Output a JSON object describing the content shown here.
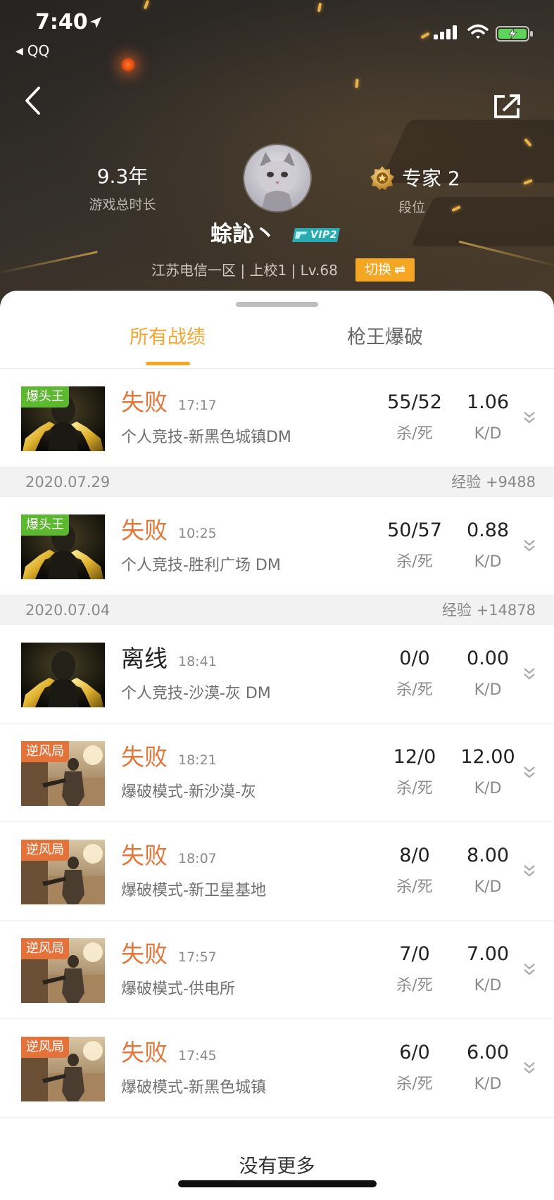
{
  "status_bar": {
    "time": "7:40",
    "back_app_label": "QQ"
  },
  "header": {
    "play_time_value": "9.3年",
    "play_time_label": "游戏总时长",
    "rank_value": "专家 2",
    "rank_label": "段位",
    "player_name": "蜍訫丶",
    "vip_badge": "VIP2",
    "server_info": "江苏电信一区 | 上校1 | Lv.68",
    "switch_label": "切换"
  },
  "tabs": [
    {
      "label": "所有战绩",
      "active": true
    },
    {
      "label": "枪王爆破",
      "active": false
    }
  ],
  "groups": [
    {
      "records": [
        {
          "thumb": "golden-pistols-image",
          "badge": "爆头王",
          "badge_color": "#5cb82e",
          "result": "失败",
          "result_color": "#e5773a",
          "time": "17:17",
          "mode": "个人竞技-新黑色城镇DM",
          "kills_deaths": "55/52",
          "kills_deaths_label": "杀/死",
          "kd": "1.06",
          "kd_label": "K/D"
        }
      ]
    },
    {
      "date": "2020.07.29",
      "exp": "经验 +9488",
      "records": [
        {
          "thumb": "golden-pistols-image",
          "badge": "爆头王",
          "badge_color": "#5cb82e",
          "result": "失败",
          "result_color": "#e5773a",
          "time": "10:25",
          "mode": "个人竞技-胜利广场 DM",
          "kills_deaths": "50/57",
          "kills_deaths_label": "杀/死",
          "kd": "0.88",
          "kd_label": "K/D"
        }
      ]
    },
    {
      "date": "2020.07.04",
      "exp": "经验 +14878",
      "records": [
        {
          "thumb": "golden-pistols-image",
          "result": "离线",
          "result_color": "#222222",
          "time": "18:41",
          "mode": "个人竞技-沙漠-灰 DM",
          "kills_deaths": "0/0",
          "kills_deaths_label": "杀/死",
          "kd": "0.00",
          "kd_label": "K/D"
        },
        {
          "thumb": "desert-soldier-image",
          "badge": "逆风局",
          "badge_color": "#e3733a",
          "result": "失败",
          "result_color": "#e5773a",
          "time": "18:21",
          "mode": "爆破模式-新沙漠-灰",
          "kills_deaths": "12/0",
          "kills_deaths_label": "杀/死",
          "kd": "12.00",
          "kd_label": "K/D"
        },
        {
          "thumb": "desert-soldier-image",
          "badge": "逆风局",
          "badge_color": "#e3733a",
          "result": "失败",
          "result_color": "#e5773a",
          "time": "18:07",
          "mode": "爆破模式-新卫星基地",
          "kills_deaths": "8/0",
          "kills_deaths_label": "杀/死",
          "kd": "8.00",
          "kd_label": "K/D"
        },
        {
          "thumb": "desert-soldier-image",
          "badge": "逆风局",
          "badge_color": "#e3733a",
          "result": "失败",
          "result_color": "#e5773a",
          "time": "17:57",
          "mode": "爆破模式-供电所",
          "kills_deaths": "7/0",
          "kills_deaths_label": "杀/死",
          "kd": "7.00",
          "kd_label": "K/D"
        },
        {
          "thumb": "desert-soldier-image",
          "badge": "逆风局",
          "badge_color": "#e3733a",
          "result": "失败",
          "result_color": "#e5773a",
          "time": "17:45",
          "mode": "爆破模式-新黑色城镇",
          "kills_deaths": "6/0",
          "kills_deaths_label": "杀/死",
          "kd": "6.00",
          "kd_label": "K/D"
        }
      ]
    }
  ],
  "footer": {
    "no_more_label": "没有更多"
  },
  "colors": {
    "accent": "#f5a623",
    "lose": "#e5773a",
    "offline": "#222222"
  }
}
